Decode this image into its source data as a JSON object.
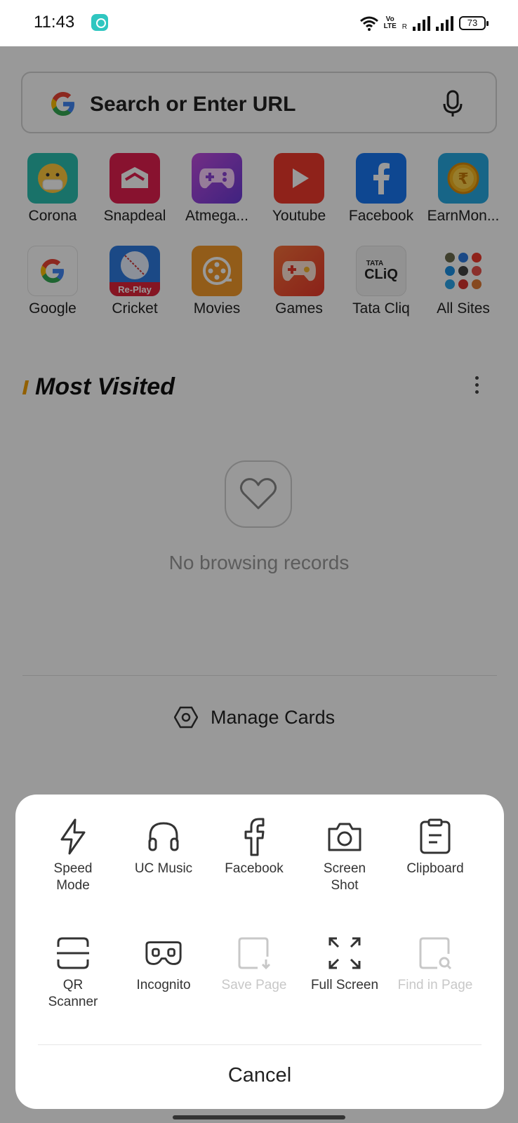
{
  "status_bar": {
    "time": "11:43",
    "volte_line1": "Vo",
    "volte_line2": "LTE",
    "roaming": "R",
    "battery": "73"
  },
  "search": {
    "placeholder": "Search or Enter URL"
  },
  "sites": [
    {
      "label": "Corona",
      "icon": "corona-mask-icon",
      "color": "#2bbfb0"
    },
    {
      "label": "Snapdeal",
      "icon": "snapdeal-icon",
      "color": "#e31f4f"
    },
    {
      "label": "Atmega...",
      "icon": "gamepad-icon",
      "color": "#8e44d8"
    },
    {
      "label": "Youtube",
      "icon": "youtube-play-icon",
      "color": "#ef3a2c"
    },
    {
      "label": "Facebook",
      "icon": "facebook-icon",
      "color": "#1877f2"
    },
    {
      "label": "EarnMon...",
      "icon": "rupee-coin-icon",
      "color": "#27a9e1"
    },
    {
      "label": "Google",
      "icon": "google-icon",
      "color": "#ffffff"
    },
    {
      "label": "Cricket",
      "icon": "cricket-ball-icon",
      "color": "#2d7be0",
      "badge": "Re-Play"
    },
    {
      "label": "Movies",
      "icon": "film-reel-icon",
      "color": "#f39a2b"
    },
    {
      "label": "Games",
      "icon": "game-controller-icon",
      "color": "#f0562a"
    },
    {
      "label": "Tata Cliq",
      "icon": "tatacliq-icon",
      "color": "#f4f4f4",
      "brand_top": "TATA",
      "brand_bottom": "CLiQ"
    },
    {
      "label": "All Sites",
      "icon": "all-sites-grid-icon",
      "color": "#ffffff"
    }
  ],
  "most_visited": {
    "title": "Most Visited",
    "empty_text": "No browsing records"
  },
  "manage_cards": {
    "label": "Manage Cards"
  },
  "tools": [
    {
      "label": "Speed Mode",
      "icon": "lightning-icon",
      "enabled": true
    },
    {
      "label": "UC Music",
      "icon": "headphones-icon",
      "enabled": true
    },
    {
      "label": "Facebook",
      "icon": "facebook-outline-icon",
      "enabled": true
    },
    {
      "label": "Screen Shot",
      "icon": "camera-icon",
      "enabled": true
    },
    {
      "label": "Clipboard",
      "icon": "clipboard-icon",
      "enabled": true
    },
    {
      "label": "QR Scanner",
      "icon": "qr-scan-icon",
      "enabled": true
    },
    {
      "label": "Incognito",
      "icon": "incognito-mask-icon",
      "enabled": true
    },
    {
      "label": "Save Page",
      "icon": "save-page-icon",
      "enabled": false
    },
    {
      "label": "Full Screen",
      "icon": "fullscreen-icon",
      "enabled": true
    },
    {
      "label": "Find in Page",
      "icon": "find-in-page-icon",
      "enabled": false
    }
  ],
  "sheet": {
    "cancel_label": "Cancel"
  },
  "colors": {
    "accent": "#f4a100",
    "overlay": "rgba(0,0,0,0.4)"
  }
}
